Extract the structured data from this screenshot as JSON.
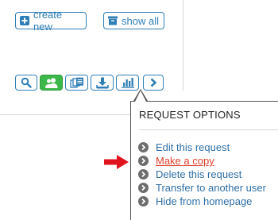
{
  "top_buttons": {
    "create_label": "create new",
    "show_label": "show all"
  },
  "toolbar": {
    "icons": [
      "search-icon",
      "users-icon",
      "documents-icon",
      "download-icon",
      "bar-chart-icon",
      "chevron-right-icon"
    ],
    "active_icon": "users-icon"
  },
  "request_options": {
    "title": "REQUEST OPTIONS",
    "items": [
      {
        "label": "Edit this request"
      },
      {
        "label": "Make a copy",
        "highlighted": true
      },
      {
        "label": "Delete this request"
      },
      {
        "label": "Transfer to another user"
      },
      {
        "label": "Hide from homepage"
      }
    ]
  },
  "colors": {
    "link_blue": "#2f7fb6",
    "active_green": "#3cb84a",
    "highlight_red": "#e0412b",
    "pointer_arrow": "#e0141e",
    "bullet_gray": "#6d6d6d"
  }
}
